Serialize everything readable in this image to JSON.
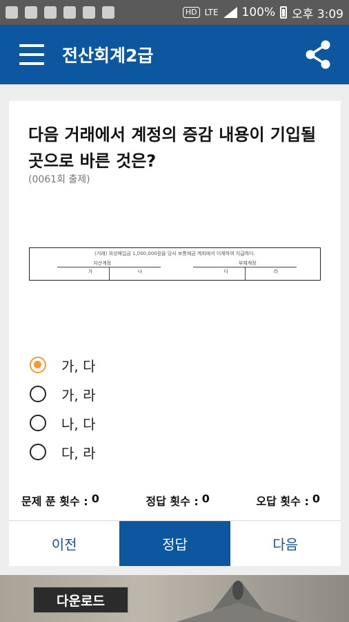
{
  "status_bar": {
    "battery": "100%",
    "time": "오후 3:09",
    "network": "LTE",
    "hd": "HD"
  },
  "app_bar": {
    "title": "전산회계2급",
    "menu_icon": "hamburger-menu-icon",
    "share_icon": "share-icon"
  },
  "question": {
    "text": "다음 거래에서 계정의 증감 내용이 기입될 곳으로 바른 것은?",
    "source": "(0061회 출제)"
  },
  "table_image": {
    "caption": "(거래) 외상매입금 1,000,000원을 당사 보통예금 계좌에서 이체하여 지급하다.",
    "left_header": "자산계정",
    "right_header": "부채계정",
    "cells": [
      "가",
      "나",
      "다",
      "라"
    ]
  },
  "options": [
    {
      "label": "가, 다",
      "selected": true
    },
    {
      "label": "가, 라",
      "selected": false
    },
    {
      "label": "나, 다",
      "selected": false
    },
    {
      "label": "다, 라",
      "selected": false
    }
  ],
  "stats": {
    "solved_label": "문제 푼 횟수 :",
    "solved_value": "0",
    "correct_label": "정답 횟수 :",
    "correct_value": "0",
    "wrong_label": "오답 횟수 :",
    "wrong_value": "0"
  },
  "buttons": {
    "prev": "이전",
    "answer": "정답",
    "next": "다음"
  },
  "ad": {
    "download_label": "다운로드"
  },
  "colors": {
    "primary": "#0d57a0",
    "accent": "#f39c2d",
    "status_bar": "#5a5a5a"
  }
}
